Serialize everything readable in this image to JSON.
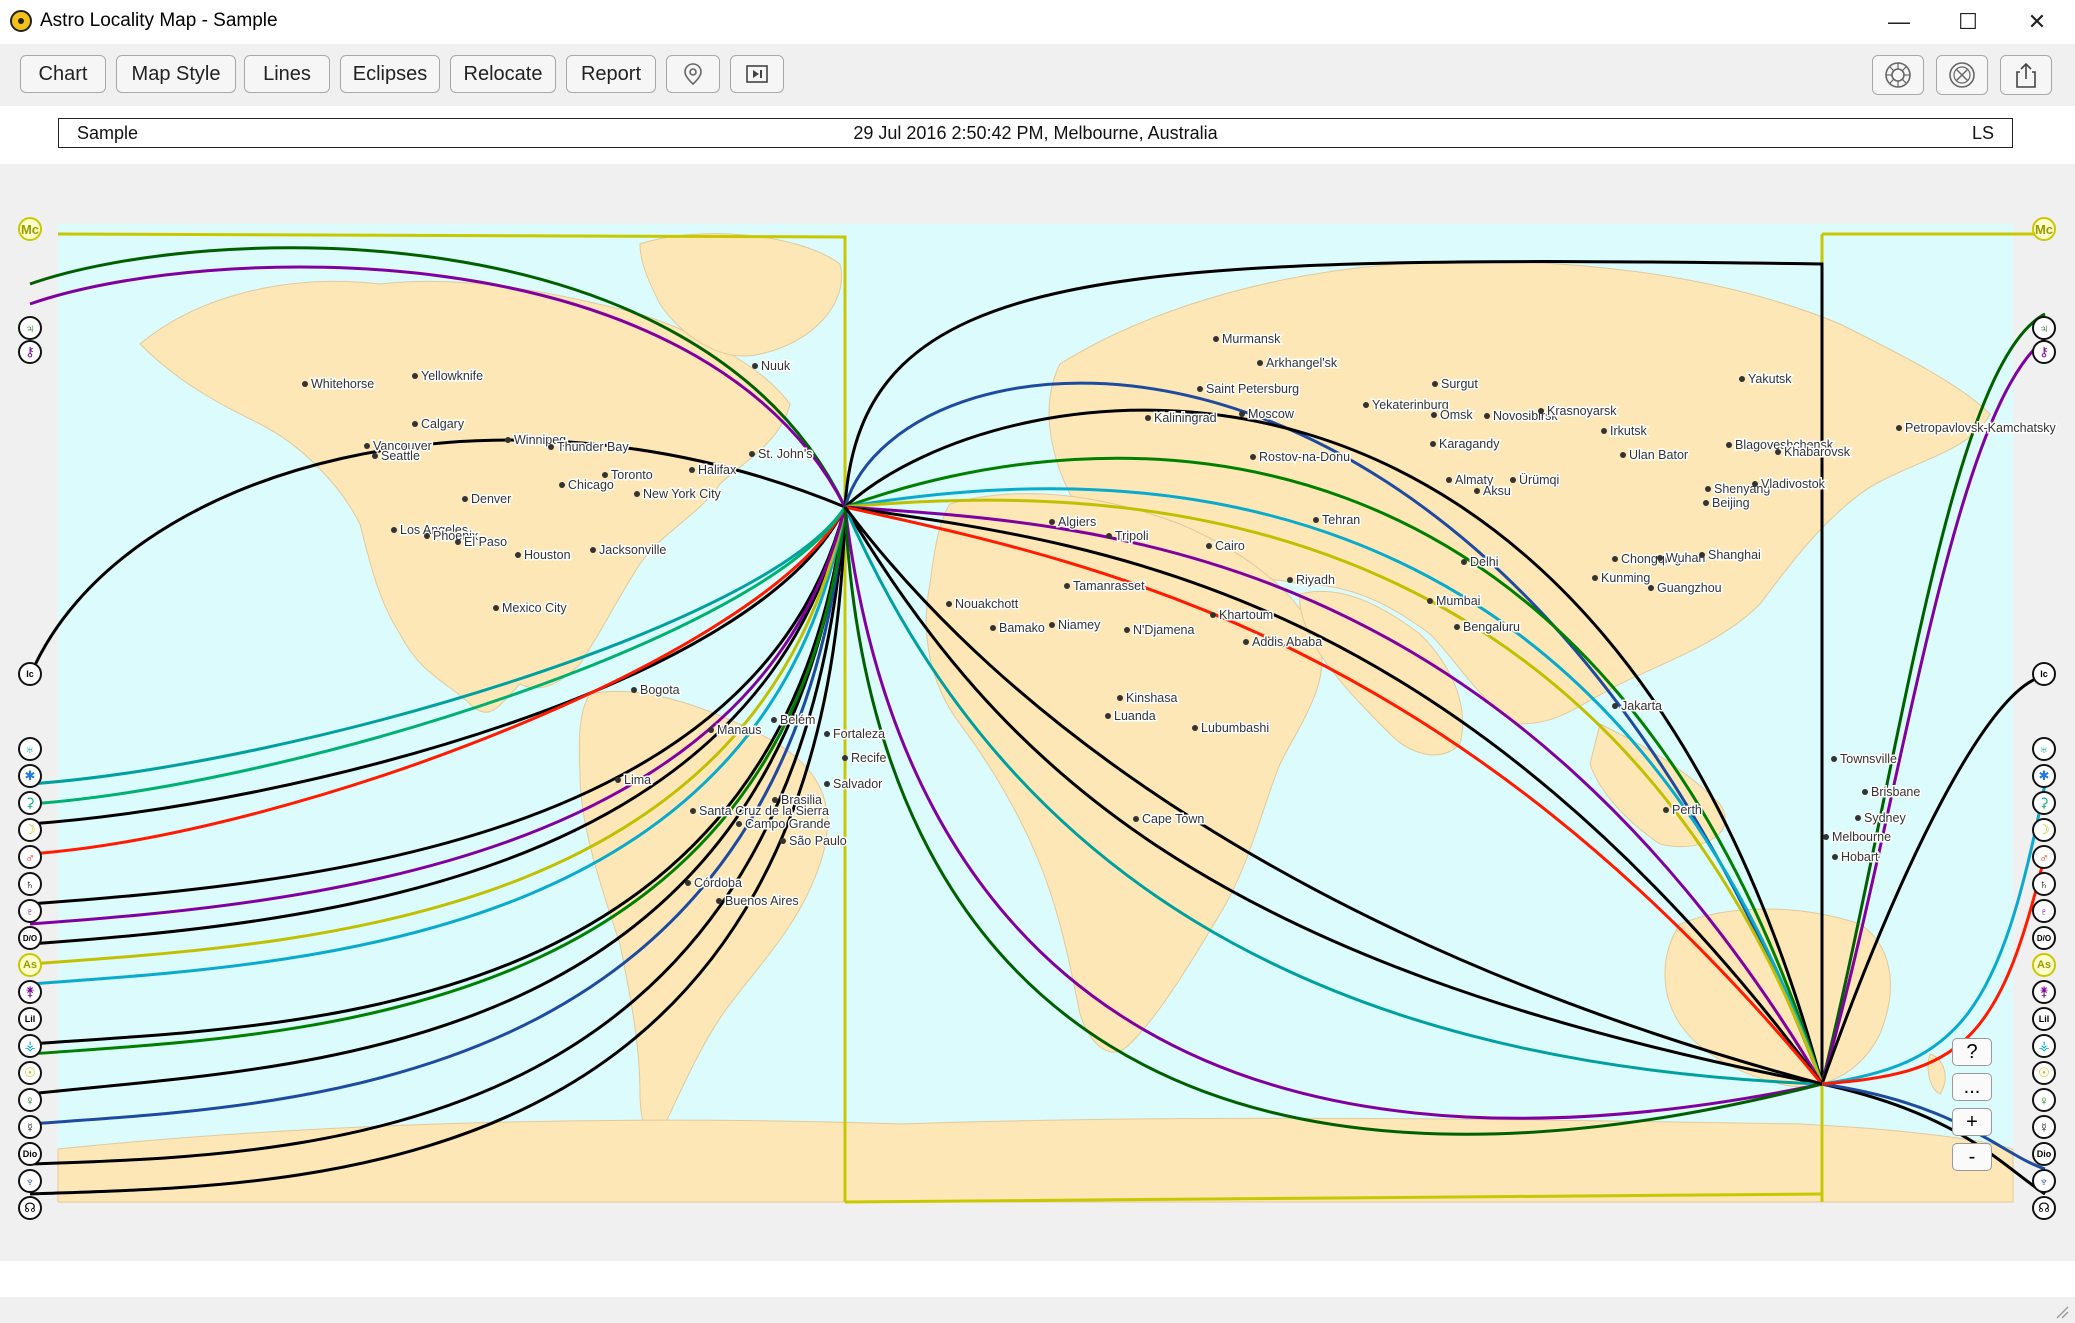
{
  "window": {
    "title": "Astro Locality Map - Sample",
    "minimize": "—",
    "maximize": "☐",
    "close": "✕"
  },
  "toolbar": {
    "chart": "Chart",
    "map_style": "Map Style",
    "lines": "Lines",
    "eclipses": "Eclipses",
    "relocate": "Relocate",
    "report": "Report"
  },
  "info": {
    "name": "Sample",
    "datetime": "29 Jul 2016 2:50:42 PM, Melbourne, Australia",
    "code": "LS"
  },
  "zoom": {
    "help": "?",
    "more": "...",
    "zoom_in": "+",
    "zoom_out": "-"
  },
  "colors": {
    "ocean": "#dcfbfc",
    "land": "#fde7b7",
    "mc_line": "#c8c800"
  },
  "glyphs": {
    "mc": "Mc",
    "jupiter": "♃",
    "chiron": "⚷",
    "ic": "Ic",
    "uranus": "♅",
    "neptune_star": "✱",
    "ceres": "⚳",
    "moon": "☽",
    "mars": "♂",
    "saturn": "♄",
    "pluto": "♇",
    "dsc": "D/O",
    "asc": "As",
    "juno": "⚵",
    "lilith": "Lil",
    "vesta": "⚶",
    "sun": "☉",
    "venus": "♀",
    "mercury": "☿",
    "dio": "Dio",
    "neptune": "♆",
    "node": "☊"
  },
  "cities": [
    {
      "name": "Whitehorse"
    },
    {
      "name": "Yellowknife"
    },
    {
      "name": "Nuuk"
    },
    {
      "name": "Calgary"
    },
    {
      "name": "Winnipeg"
    },
    {
      "name": "Vancouver"
    },
    {
      "name": "Seattle"
    },
    {
      "name": "Thunder Bay"
    },
    {
      "name": "St. John's"
    },
    {
      "name": "Toronto"
    },
    {
      "name": "Halifax"
    },
    {
      "name": "Chicago"
    },
    {
      "name": "New York City"
    },
    {
      "name": "Denver"
    },
    {
      "name": "Los Angeles"
    },
    {
      "name": "Phoenix"
    },
    {
      "name": "El Paso"
    },
    {
      "name": "Houston"
    },
    {
      "name": "Jacksonville"
    },
    {
      "name": "Mexico City"
    },
    {
      "name": "Bogota"
    },
    {
      "name": "Manaus"
    },
    {
      "name": "Belém"
    },
    {
      "name": "Fortaleza"
    },
    {
      "name": "Recife"
    },
    {
      "name": "Lima"
    },
    {
      "name": "Salvador"
    },
    {
      "name": "Brasilia"
    },
    {
      "name": "Santa Cruz de la Sierra"
    },
    {
      "name": "Campo Grande"
    },
    {
      "name": "São Paulo"
    },
    {
      "name": "Córdoba"
    },
    {
      "name": "Buenos Aires"
    },
    {
      "name": "Murmansk"
    },
    {
      "name": "Arkhangel'sk"
    },
    {
      "name": "Saint Petersburg"
    },
    {
      "name": "Kaliningrad"
    },
    {
      "name": "Moscow"
    },
    {
      "name": "Rostov-na-Donu"
    },
    {
      "name": "Surgut"
    },
    {
      "name": "Yekaterinburg"
    },
    {
      "name": "Omsk"
    },
    {
      "name": "Novosibirsk"
    },
    {
      "name": "Krasnoyarsk"
    },
    {
      "name": "Irkutsk"
    },
    {
      "name": "Karagandy"
    },
    {
      "name": "Ulan Bator"
    },
    {
      "name": "Yakutsk"
    },
    {
      "name": "Blagoveshchensk"
    },
    {
      "name": "Khabarovsk"
    },
    {
      "name": "Petropavlovsk-Kamchatsky"
    },
    {
      "name": "Almaty"
    },
    {
      "name": "Aksu"
    },
    {
      "name": "Ürümqi"
    },
    {
      "name": "Shenyang"
    },
    {
      "name": "Vladivostok"
    },
    {
      "name": "Beijing"
    },
    {
      "name": "Algiers"
    },
    {
      "name": "Tripoli"
    },
    {
      "name": "Cairo"
    },
    {
      "name": "Tehran"
    },
    {
      "name": "Riyadh"
    },
    {
      "name": "Delhi"
    },
    {
      "name": "Chongqing"
    },
    {
      "name": "Wuhan"
    },
    {
      "name": "Shanghai"
    },
    {
      "name": "Kunming"
    },
    {
      "name": "Guangzhou"
    },
    {
      "name": "Tamanrasset"
    },
    {
      "name": "Nouakchott"
    },
    {
      "name": "Bamako"
    },
    {
      "name": "Niamey"
    },
    {
      "name": "N'Djamena"
    },
    {
      "name": "Khartoum"
    },
    {
      "name": "Addis Ababa"
    },
    {
      "name": "Mumbai"
    },
    {
      "name": "Bengaluru"
    },
    {
      "name": "Kinshasa"
    },
    {
      "name": "Luanda"
    },
    {
      "name": "Lubumbashi"
    },
    {
      "name": "Jakarta"
    },
    {
      "name": "Cape Town"
    },
    {
      "name": "Townsville"
    },
    {
      "name": "Brisbane"
    },
    {
      "name": "Sydney"
    },
    {
      "name": "Perth"
    },
    {
      "name": "Melbourne"
    },
    {
      "name": "Hobart"
    }
  ]
}
